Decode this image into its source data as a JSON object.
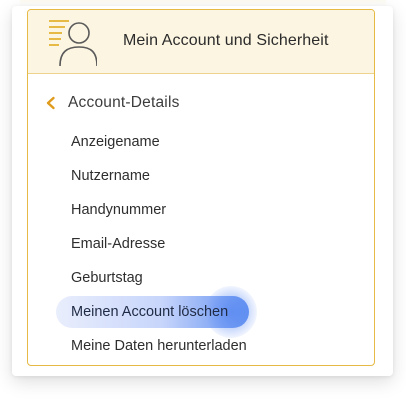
{
  "header": {
    "title": "Mein Account und Sicherheit",
    "icon": "account-list-icon"
  },
  "section": {
    "back_icon": "chevron-left-icon",
    "title": "Account-Details"
  },
  "menu": {
    "items": [
      {
        "label": "Anzeigename"
      },
      {
        "label": "Nutzername"
      },
      {
        "label": "Handynummer"
      },
      {
        "label": "Email-Adresse"
      },
      {
        "label": "Geburtstag"
      },
      {
        "label": "Meinen Account löschen",
        "highlighted": true
      },
      {
        "label": "Meine Daten herunterladen"
      }
    ]
  },
  "colors": {
    "accent": "#e6ba45",
    "header_bg": "#fcf5e2",
    "highlight": "#5f8ff0"
  }
}
